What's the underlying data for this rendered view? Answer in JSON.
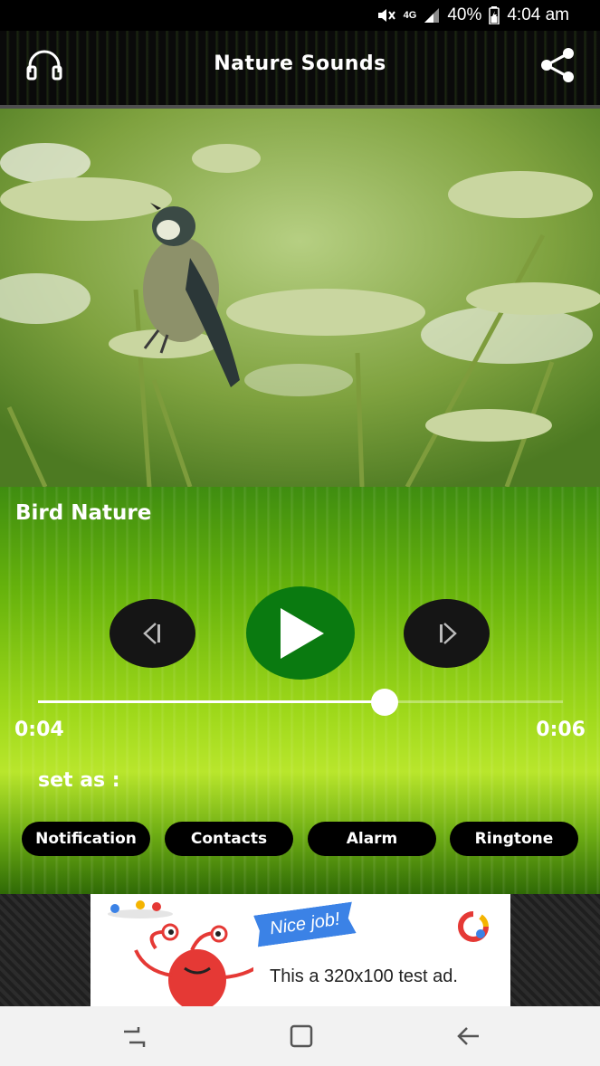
{
  "status": {
    "network": "4G",
    "battery": "40%",
    "time": "4:04 am"
  },
  "header": {
    "title": "Nature Sounds"
  },
  "player": {
    "track_title": "Bird Nature",
    "current_time": "0:04",
    "total_time": "0:06",
    "progress": 0.66
  },
  "set_as": {
    "label": "set as :",
    "options": [
      "Notification",
      "Contacts",
      "Alarm",
      "Ringtone"
    ]
  },
  "ad": {
    "badge": "Nice job!",
    "text": "This a 320x100 test ad."
  },
  "icons": [
    "headphones-icon",
    "share-icon",
    "previous-icon",
    "play-icon",
    "next-icon",
    "back-icon",
    "home-icon",
    "recents-icon"
  ],
  "colors": {
    "play_button": "#0a7a10",
    "ad_badge": "#3b82e6"
  }
}
